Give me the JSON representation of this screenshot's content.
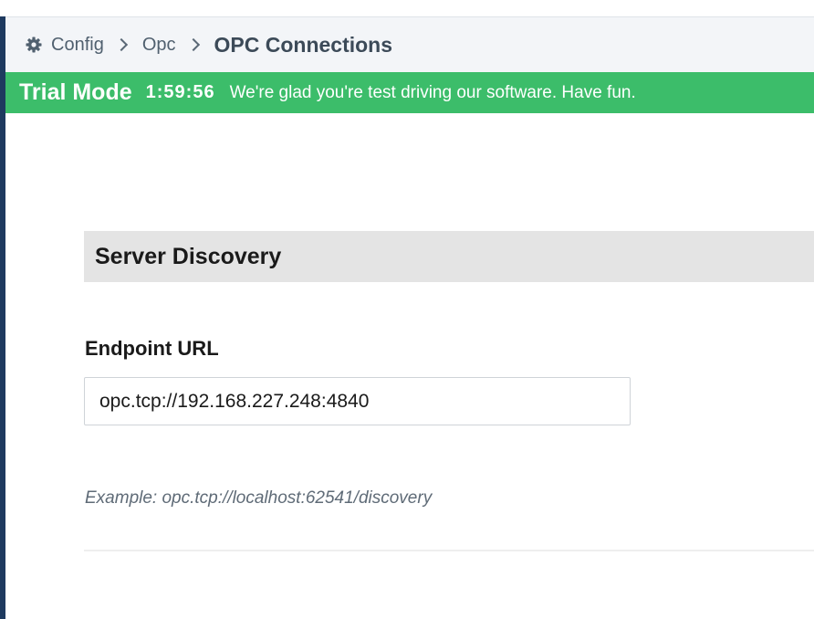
{
  "breadcrumb": {
    "icon": "gear-icon",
    "items": [
      "Config",
      "Opc",
      "OPC Connections"
    ]
  },
  "trial": {
    "title": "Trial Mode",
    "timer": "1:59:56",
    "message": "We're glad you're test driving our software. Have fun."
  },
  "discovery": {
    "section_title": "Server Discovery",
    "endpoint_label": "Endpoint URL",
    "endpoint_value": "opc.tcp://192.168.227.248:4840",
    "example_text": "Example: opc.tcp://localhost:62541/discovery"
  },
  "colors": {
    "trial_banner": "#3cbd6a",
    "left_rail": "#1e3a5f",
    "section_header_bg": "#e4e4e4"
  }
}
